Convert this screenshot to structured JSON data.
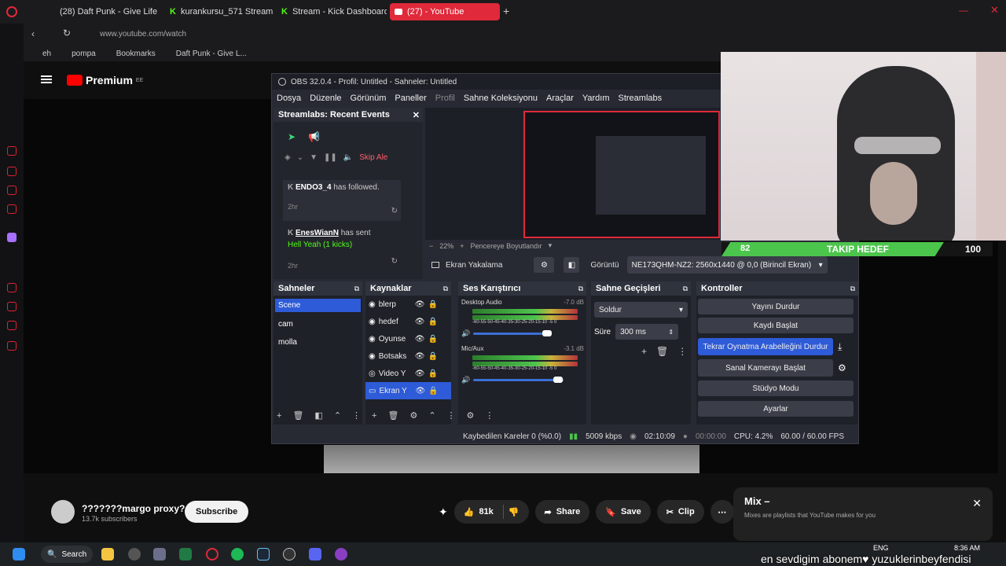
{
  "browser": {
    "tabs": [
      "(28) Daft Punk - Give Life",
      "kurankursu_571 Stream -",
      "Stream - Kick Dashboard",
      "(27) - YouTube"
    ],
    "url": "www.youtube.com/watch",
    "bookmarks": [
      "eh",
      "pompa",
      "Bookmarks",
      "Daft Punk - Give L..."
    ]
  },
  "youtube": {
    "logo": "Premium",
    "region": "EE"
  },
  "obs": {
    "title": "OBS 32.0.4 - Profil: Untitled - Sahneler: Untitled",
    "menu": [
      "Dosya",
      "Düzenle",
      "Görünüm",
      "Paneller",
      "Profil",
      "Sahne Koleksiyonu",
      "Araçlar",
      "Yardım",
      "Streamlabs"
    ],
    "events": {
      "title": "Streamlabs: Recent Events",
      "skip": "Skip Ale",
      "items": [
        {
          "user": "ENDO3_4",
          "text": "has followed.",
          "time": "2hr"
        },
        {
          "user": "EnesWianN",
          "text": "has sent",
          "extra": "Hell Yeah (1 kicks)",
          "time": "2hr"
        }
      ]
    },
    "preview": {
      "zoom": "22%",
      "fit": "Pencereye Boyutlandır"
    },
    "capture": {
      "label": "Ekran Yakalama",
      "display_label": "Görüntü",
      "display_value": "NE173QHM-NZ2: 2560x1440 @ 0,0 (Birincil Ekran)"
    },
    "scenes": {
      "title": "Sahneler",
      "items": [
        "Scene",
        "cam",
        "molla"
      ]
    },
    "sources": {
      "title": "Kaynaklar",
      "items": [
        "blerp",
        "hedef",
        "Oyunse",
        "Botsaks",
        "Video Y",
        "Ekran Y"
      ]
    },
    "mixer": {
      "title": "Ses Karıştırıcı",
      "channels": [
        {
          "name": "Desktop Audio",
          "db": "-7.0 dB",
          "level": 0.7
        },
        {
          "name": "Mic/Aux",
          "db": "-3.1 dB",
          "level": 0.86
        }
      ],
      "scale": "-60-55-50-45-40-35-30-25-20-15-10 -5  0"
    },
    "transitions": {
      "title": "Sahne Geçişleri",
      "type": "Soldur",
      "duration_label": "Süre",
      "duration": "300 ms"
    },
    "controls": {
      "title": "Kontroller",
      "buttons": [
        "Yayını Durdur",
        "Kaydı Başlat",
        "Tekrar Oynatma Arabelleğini Durdur",
        "Sanal Kamerayı Başlat",
        "Stüdyo Modu",
        "Ayarlar"
      ]
    },
    "status": {
      "dropped": "Kaybedilen Kareler 0 (%0.0)",
      "bitrate": "5009 kbps",
      "stream_time": "02:10:09",
      "rec_time": "00:00:00",
      "cpu": "CPU: 4.2%",
      "fps": "60.00 / 60.00 FPS"
    }
  },
  "goal": {
    "current": "82",
    "label": "TAKIP HEDEF",
    "target": "100",
    "fraction": 0.82
  },
  "channel": {
    "name": "???????margo proxy?",
    "subs": "13.7k subscribers",
    "subscribe": "Subscribe"
  },
  "actions": {
    "likes": "81k",
    "share": "Share",
    "save": "Save",
    "clip": "Clip"
  },
  "mix": {
    "title": "Mix –",
    "desc": "Mixes are playlists that YouTube makes for you"
  },
  "taskbar": {
    "search": "Search",
    "lang": "ENG",
    "time": "8:36 AM"
  },
  "overlay_text": "en sevdigim abonem♥ yuzuklerinbeyfendisi",
  "colors": {
    "accent": "#e0293a",
    "obs_blue": "#2e5bd7",
    "goal_green": "#4cc54c"
  }
}
